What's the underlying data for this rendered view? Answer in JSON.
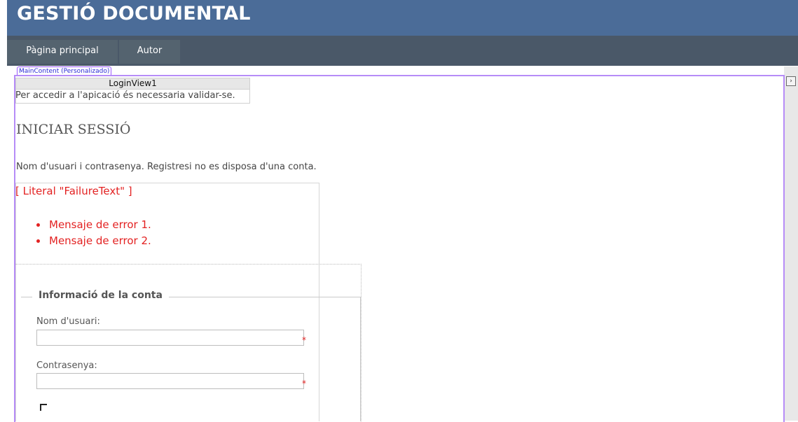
{
  "header": {
    "title": "GESTIÓ DOCUMENTAL"
  },
  "nav": {
    "items": [
      {
        "label": "Pàgina principal"
      },
      {
        "label": "Autor"
      }
    ]
  },
  "designer": {
    "main_content_tag": "MainContent (Personalizado)",
    "login_view_tag": "LoginView1",
    "failure_literal": "[ Literal \"FailureText\" ]",
    "scroll_glyph": "›"
  },
  "login_view": {
    "anonymous_text": "Per accedir a l'apicació és necessaria validar-se."
  },
  "login": {
    "heading": "INICIAR SESSIÓ",
    "instructions": "Nom d'usuari i contrasenya. Registresi no es disposa d'una conta.",
    "errors": [
      "Mensaje de error 1.",
      "Mensaje de error 2."
    ],
    "fieldset_legend": "Informació de la conta",
    "username_label": "Nom d'usuari:",
    "username_value": "",
    "password_label": "Contrasenya:",
    "password_value": "",
    "required_mark": "*"
  },
  "colors": {
    "header_bg": "#4b6c98",
    "nav_bg": "#4a5868",
    "error": "#e32222",
    "designer_border": "#b68cf7"
  }
}
